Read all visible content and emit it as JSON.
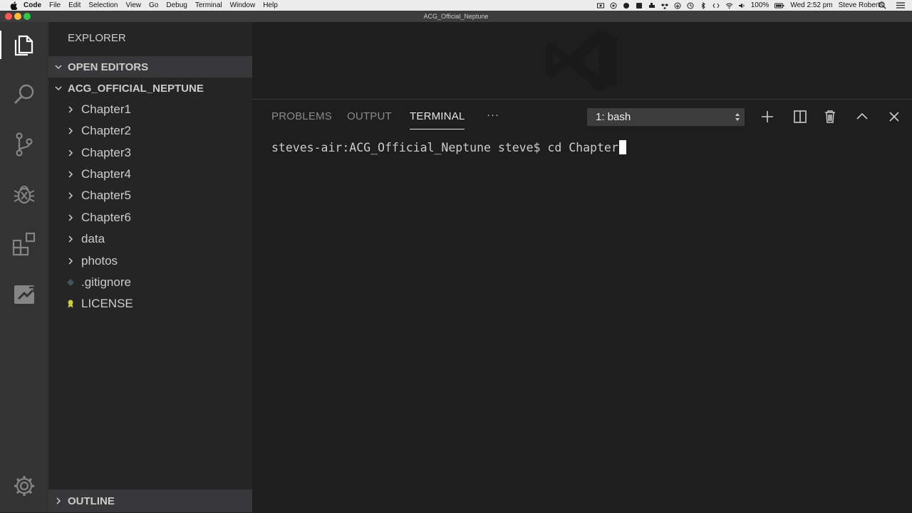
{
  "menubar": {
    "app": "Code",
    "items": [
      "File",
      "Edit",
      "Selection",
      "View",
      "Go",
      "Debug",
      "Terminal",
      "Window",
      "Help"
    ],
    "battery": "100%",
    "clock": "Wed 2:52 pm",
    "user": "Steve Roberts"
  },
  "window": {
    "title": "ACG_Official_Neptune"
  },
  "activity_bar": {
    "icons": [
      "explorer-icon",
      "search-icon",
      "source-control-icon",
      "debug-icon",
      "extensions-icon",
      "remote-icon",
      "settings-gear-icon"
    ],
    "active": "explorer-icon"
  },
  "sidebar": {
    "title": "EXPLORER",
    "open_editors": "OPEN EDITORS",
    "folder": "ACG_OFFICIAL_NEPTUNE",
    "items": [
      {
        "label": "Chapter1",
        "kind": "folder"
      },
      {
        "label": "Chapter2",
        "kind": "folder"
      },
      {
        "label": "Chapter3",
        "kind": "folder"
      },
      {
        "label": "Chapter4",
        "kind": "folder"
      },
      {
        "label": "Chapter5",
        "kind": "folder"
      },
      {
        "label": "Chapter6",
        "kind": "folder"
      },
      {
        "label": "data",
        "kind": "folder"
      },
      {
        "label": "photos",
        "kind": "folder"
      },
      {
        "label": ".gitignore",
        "kind": "file"
      },
      {
        "label": "LICENSE",
        "kind": "file"
      }
    ],
    "outline": "OUTLINE"
  },
  "panel": {
    "tabs": [
      "PROBLEMS",
      "OUTPUT",
      "TERMINAL"
    ],
    "active_tab": "TERMINAL",
    "more": "···",
    "terminal_select": "1: bash",
    "actions": [
      "add-terminal-icon",
      "split-terminal-icon",
      "trash-icon",
      "maximize-panel-icon",
      "close-panel-icon"
    ],
    "terminal_line": "steves-air:ACG_Official_Neptune steve$ cd Chapter"
  },
  "colors": {
    "activity_bar": "#333333",
    "sidebar": "#252526",
    "editor": "#1e1e1e",
    "section_header": "#38383a",
    "title_bar": "#3c3c3c"
  }
}
